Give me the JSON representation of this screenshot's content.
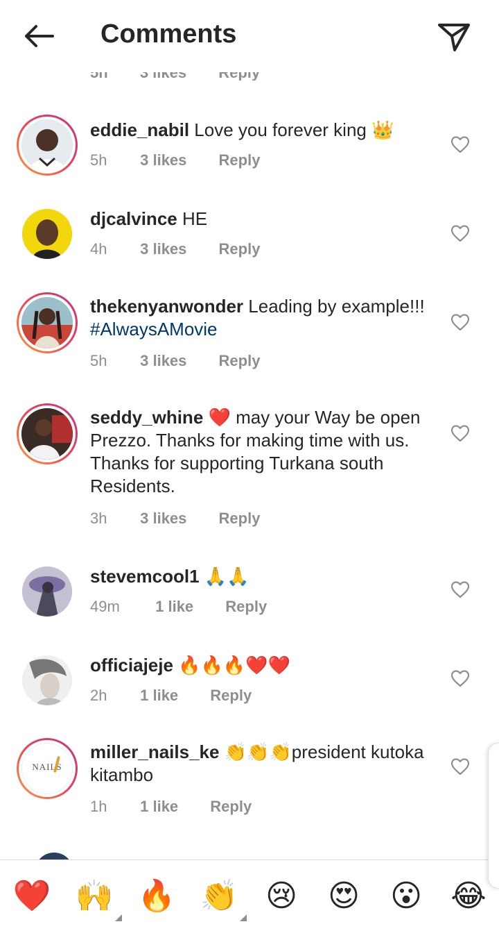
{
  "header": {
    "title": "Comments",
    "back_icon": "arrow-left-icon",
    "share_icon": "paper-plane-icon"
  },
  "cut_row": {
    "time": "5h",
    "likes": "3 likes",
    "reply": "Reply"
  },
  "comments": [
    {
      "username": "eddie_nabil",
      "text": " Love you forever king 👑",
      "hashtag": "",
      "time": "5h",
      "likes": "3 likes",
      "reply": "Reply"
    },
    {
      "username": "djcalvince",
      "text": " HE",
      "hashtag": "",
      "time": "4h",
      "likes": "3 likes",
      "reply": "Reply"
    },
    {
      "username": "thekenyanwonder",
      "text": " Leading by example!!! ",
      "hashtag": "#AlwaysAMovie",
      "time": "5h",
      "likes": "3 likes",
      "reply": "Reply"
    },
    {
      "username": "seddy_whine",
      "text": " ❤️ may your Way be open Prezzo. Thanks for making time with us. Thanks for supporting Turkana south Residents.",
      "hashtag": "",
      "time": "3h",
      "likes": "3 likes",
      "reply": "Reply"
    },
    {
      "username": "stevemcool1",
      "text": " 🙏🙏",
      "hashtag": "",
      "time": "49m",
      "likes": "1 like",
      "reply": "Reply"
    },
    {
      "username": "officiajeje",
      "text": " 🔥🔥🔥❤️❤️",
      "hashtag": "",
      "time": "2h",
      "likes": "1 like",
      "reply": "Reply"
    },
    {
      "username": "miller_nails_ke",
      "text": " 👏👏👏president kutoka kitambo",
      "hashtag": "",
      "time": "1h",
      "likes": "1 like",
      "reply": "Reply"
    }
  ],
  "avatar_logo_text": "NAILS",
  "emoji_bar": [
    "❤️",
    "🙌",
    "🔥",
    "👏",
    "😢",
    "😍",
    "😮",
    "😂"
  ],
  "colors": {
    "link": "#00376b",
    "meta": "#8e8e8e",
    "text": "#262626",
    "heart_red": "#ed1c24"
  }
}
